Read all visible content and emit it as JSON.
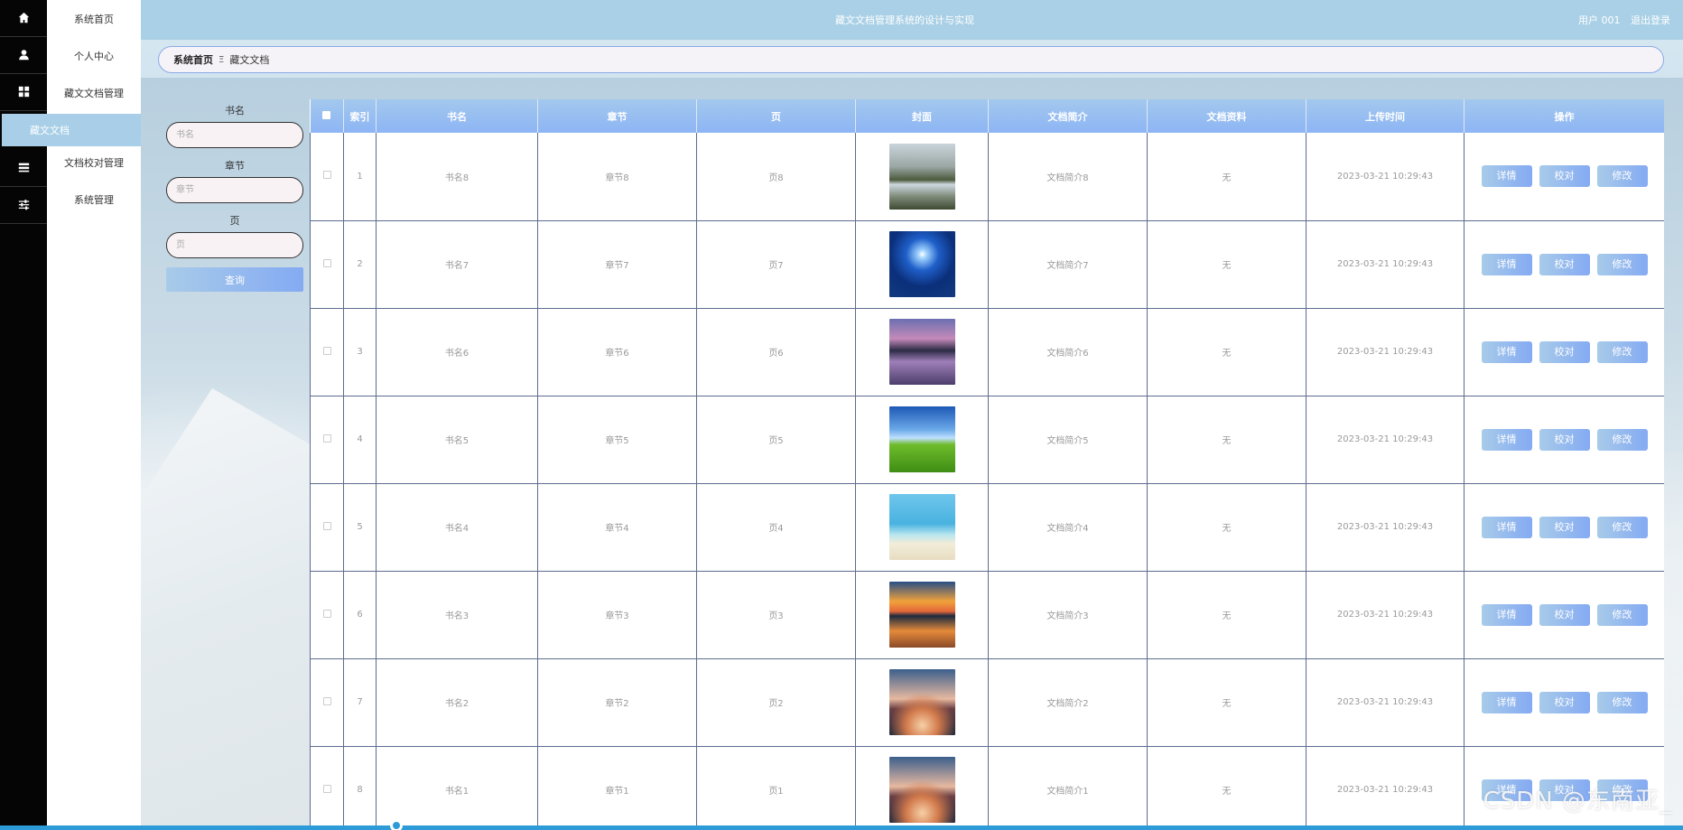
{
  "header": {
    "title": "藏文文档管理系统的设计与实现",
    "user": "用户 001",
    "logout": "退出登录"
  },
  "menu": {
    "items": [
      {
        "label": "系统首页",
        "icon": "home-icon"
      },
      {
        "label": "个人中心",
        "icon": "user-icon"
      },
      {
        "label": "藏文文档管理",
        "icon": "grid-icon"
      },
      {
        "label": "文档校对管理",
        "icon": "list-icon"
      },
      {
        "label": "系统管理",
        "icon": "sliders-icon"
      }
    ],
    "active_sub": "藏文文档"
  },
  "breadcrumb": {
    "home": "系统首页",
    "separator": "Ξ",
    "current": "藏文文档"
  },
  "search": {
    "fields": [
      {
        "label": "书名",
        "placeholder": "书名"
      },
      {
        "label": "章节",
        "placeholder": "章节"
      },
      {
        "label": "页",
        "placeholder": "页"
      }
    ],
    "button": "查询"
  },
  "table": {
    "columns": [
      "索引",
      "书名",
      "章节",
      "页",
      "封面",
      "文档简介",
      "文档资料",
      "上传时间",
      "操作"
    ],
    "actions": [
      "详情",
      "校对",
      "修改"
    ],
    "rows": [
      {
        "index": "1",
        "book": "书名8",
        "chapter": "章节8",
        "page": "页8",
        "cover": "mountain-lake",
        "intro": "文档简介8",
        "material": "无",
        "time": "2023-03-21 10:29:43"
      },
      {
        "index": "2",
        "book": "书名7",
        "chapter": "章节7",
        "page": "页7",
        "cover": "blue-sun",
        "intro": "文档简介7",
        "material": "无",
        "time": "2023-03-21 10:29:43"
      },
      {
        "index": "3",
        "book": "书名6",
        "chapter": "章节6",
        "page": "页6",
        "cover": "purple-lake",
        "intro": "文档简介6",
        "material": "无",
        "time": "2023-03-21 10:29:43"
      },
      {
        "index": "4",
        "book": "书名5",
        "chapter": "章节5",
        "page": "页5",
        "cover": "green-field",
        "intro": "文档简介5",
        "material": "无",
        "time": "2023-03-21 10:29:43"
      },
      {
        "index": "5",
        "book": "书名4",
        "chapter": "章节4",
        "page": "页4",
        "cover": "beach",
        "intro": "文档简介4",
        "material": "无",
        "time": "2023-03-21 10:29:43"
      },
      {
        "index": "6",
        "book": "书名3",
        "chapter": "章节3",
        "page": "页3",
        "cover": "sunset-lake",
        "intro": "文档简介3",
        "material": "无",
        "time": "2023-03-21 10:29:43"
      },
      {
        "index": "7",
        "book": "书名2",
        "chapter": "章节2",
        "page": "页2",
        "cover": "boat-sunset",
        "intro": "文档简介2",
        "material": "无",
        "time": "2023-03-21 10:29:43"
      },
      {
        "index": "8",
        "book": "书名1",
        "chapter": "章节1",
        "page": "页1",
        "cover": "boat-sunset",
        "intro": "文档简介1",
        "material": "无",
        "time": "2023-03-21 10:29:43"
      }
    ]
  },
  "colors": {
    "header": "#a9d0e6",
    "accent_from": "#a8cbe9",
    "accent_to": "#84aaf3",
    "rail": "#050505"
  },
  "overlay": {
    "watermark": "CSDN @东南亚_"
  }
}
